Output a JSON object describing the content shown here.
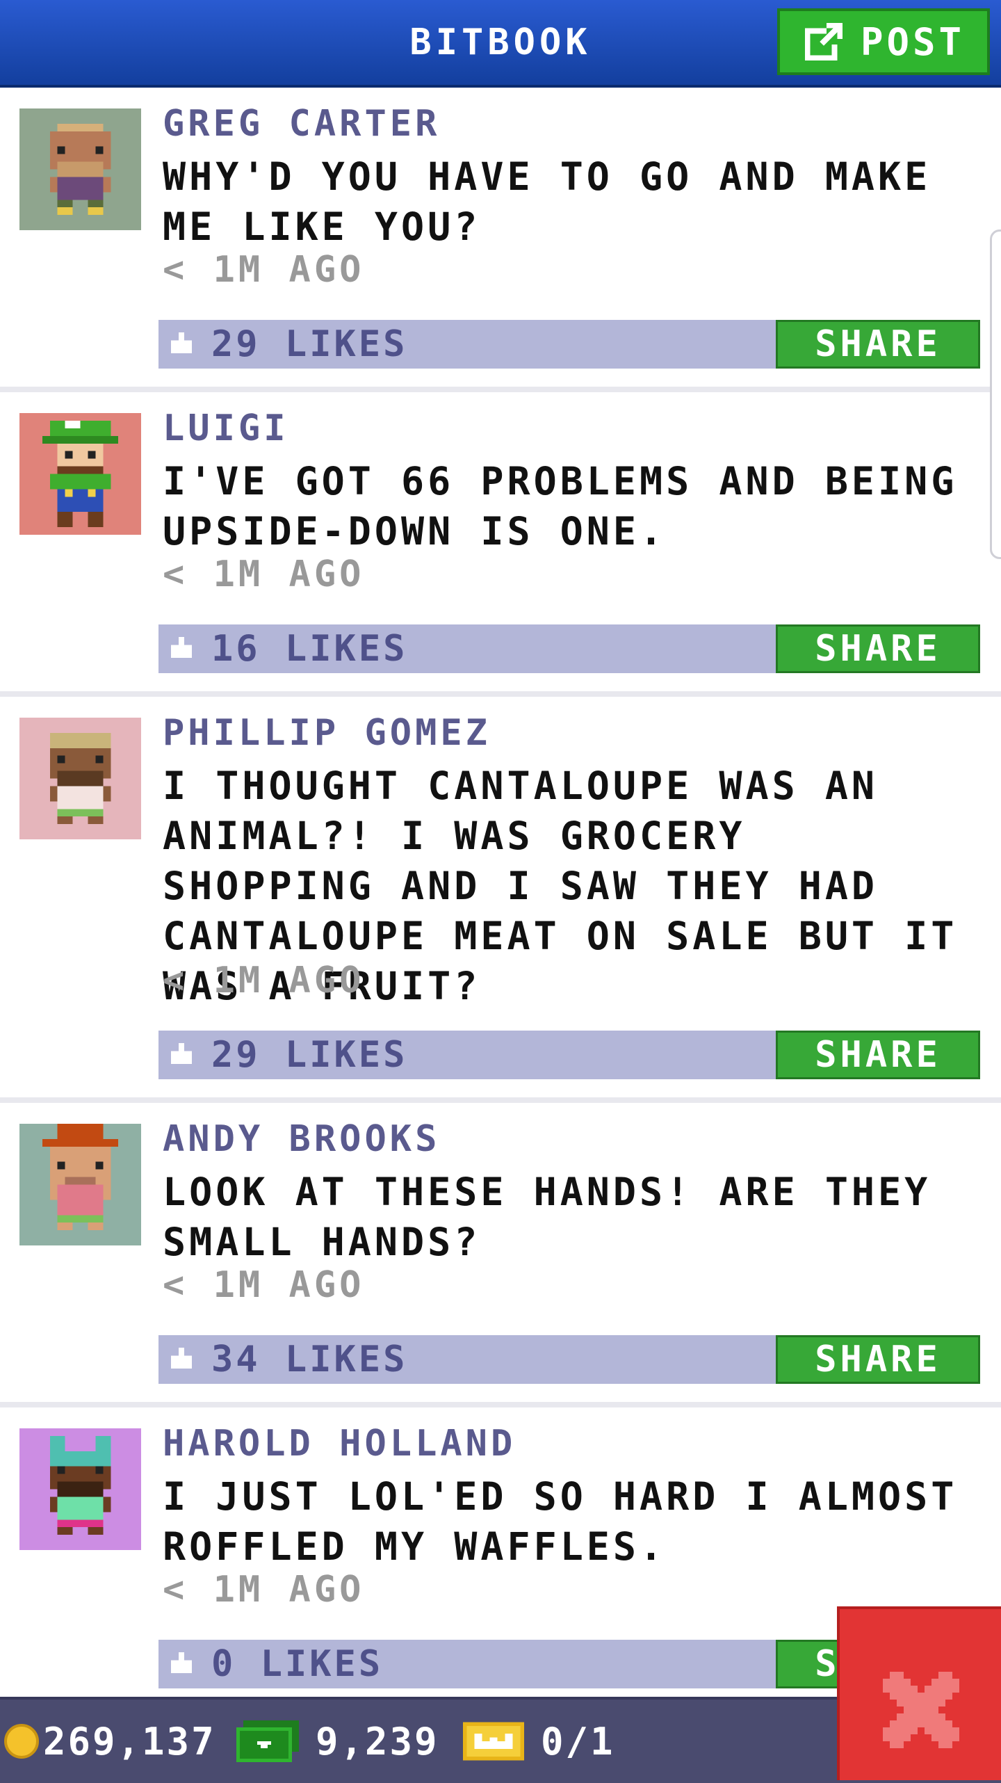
{
  "header": {
    "title": "BITBOOK",
    "post_label": "POST"
  },
  "posts": [
    {
      "author": "GREG CARTER",
      "message": "WHY'D YOU HAVE TO GO AND MAKE ME LIKE YOU?",
      "time": "< 1M AGO",
      "likes": "29 LIKES",
      "share": "SHARE",
      "avatar_bg": "#8fa58e"
    },
    {
      "author": "LUIGI",
      "message": "I'VE GOT 66 PROBLEMS AND BEING UPSIDE-DOWN IS ONE.",
      "time": "< 1M AGO",
      "likes": "16 LIKES",
      "share": "SHARE",
      "avatar_bg": "#e0837a"
    },
    {
      "author": "PHILLIP GOMEZ",
      "message": "I THOUGHT CANTALOUPE WAS AN ANIMAL?! I WAS GROCERY SHOPPING AND I SAW THEY HAD CANTALOUPE MEAT ON SALE BUT IT WAS A FRUIT?",
      "time": "< 1M AGO",
      "likes": "29 LIKES",
      "share": "SHARE",
      "avatar_bg": "#e5b5bb"
    },
    {
      "author": "ANDY BROOKS",
      "message": "LOOK AT THESE HANDS! ARE THEY SMALL HANDS?",
      "time": "< 1M AGO",
      "likes": "34 LIKES",
      "share": "SHARE",
      "avatar_bg": "#8fb0a4"
    },
    {
      "author": "HAROLD HOLLAND",
      "message": "I JUST LOL'ED SO HARD I ALMOST ROFFLED MY WAFFLES.",
      "time": "< 1M AGO",
      "likes": "0 LIKES",
      "share": "SHARE",
      "avatar_bg": "#cc8de3"
    }
  ],
  "bottom_bar": {
    "coins": "269,137",
    "bux": "9,239",
    "vip": "0/1"
  },
  "colors": {
    "header": "#1f4fbf",
    "accent_green": "#2fb52f",
    "likebar": "#b3b6d8",
    "close": "#e23434"
  }
}
